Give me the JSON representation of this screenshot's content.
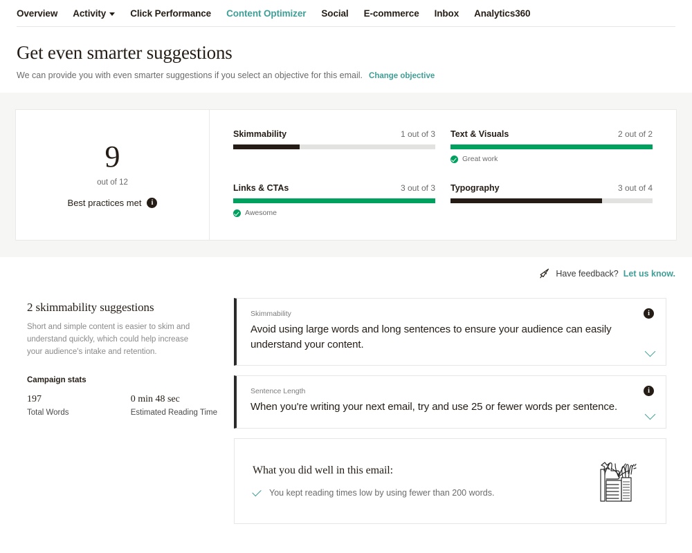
{
  "nav": {
    "items": [
      {
        "label": "Overview",
        "active": false,
        "caret": false
      },
      {
        "label": "Activity",
        "active": false,
        "caret": true
      },
      {
        "label": "Click Performance",
        "active": false,
        "caret": false
      },
      {
        "label": "Content Optimizer",
        "active": true,
        "caret": false
      },
      {
        "label": "Social",
        "active": false,
        "caret": false
      },
      {
        "label": "E-commerce",
        "active": false,
        "caret": false
      },
      {
        "label": "Inbox",
        "active": false,
        "caret": false
      },
      {
        "label": "Analytics360",
        "active": false,
        "caret": false
      }
    ]
  },
  "header": {
    "title": "Get even smarter suggestions",
    "subtitle": "We can provide you with even smarter suggestions if you select an objective for this email.",
    "change_objective_label": "Change objective"
  },
  "score": {
    "value": "9",
    "out_of": "out of 12",
    "label": "Best practices met",
    "info_glyph": "i"
  },
  "metrics": [
    {
      "name": "Skimmability",
      "count": "1 out of 3",
      "percent": 33,
      "complete": false,
      "note": ""
    },
    {
      "name": "Text & Visuals",
      "count": "2 out of 2",
      "percent": 100,
      "complete": true,
      "note": "Great work"
    },
    {
      "name": "Links & CTAs",
      "count": "3 out of 3",
      "percent": 100,
      "complete": true,
      "note": "Awesome"
    },
    {
      "name": "Typography",
      "count": "3 out of 4",
      "percent": 75,
      "complete": false,
      "note": ""
    }
  ],
  "feedback": {
    "text": "Have feedback?",
    "link": "Let us know."
  },
  "sidebar": {
    "title": "2 skimmability suggestions",
    "description": "Short and simple content is easier to skim and understand quickly, which could help increase your audience's intake and retention.",
    "stats_title": "Campaign stats",
    "stats": [
      {
        "value": "197",
        "label": "Total Words"
      },
      {
        "value": "0 min 48 sec",
        "label": "Estimated Reading Time"
      }
    ]
  },
  "suggestions": [
    {
      "kicker": "Skimmability",
      "text": "Avoid using large words and long sentences to ensure your audience can easily understand your content."
    },
    {
      "kicker": "Sentence Length",
      "text": "When you're writing your next email, try and use 25 or fewer words per sentence."
    }
  ],
  "well_done": {
    "title": "What you did well in this email:",
    "items": [
      "You kept reading times low by using fewer than 200 words."
    ]
  },
  "colors": {
    "teal": "#3f9f96",
    "green": "#00a05e",
    "dark": "#241c15",
    "band": "#f6f6f4"
  }
}
